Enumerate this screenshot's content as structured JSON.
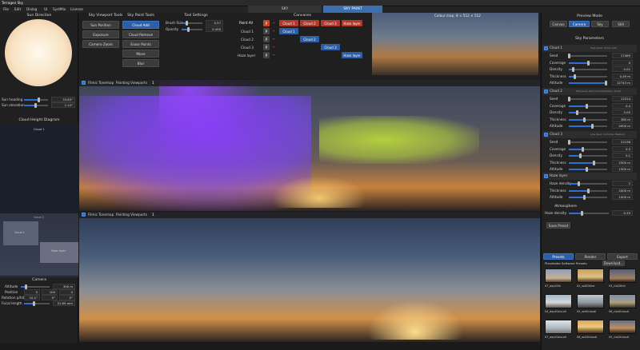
{
  "menu": {
    "title": "Terragen Sky",
    "items": [
      "File",
      "Edit",
      "Dialog",
      "UI",
      "SystMix",
      "License"
    ]
  },
  "top_tabs": [
    "SKY",
    "SKY PAINT"
  ],
  "sun": {
    "title": "Sun Direction",
    "heading_label": "Sun heading",
    "heading_value": "33.83°",
    "elevation_label": "Sun elevation",
    "elevation_value": "1.14°"
  },
  "cloud_diagram": {
    "title": "Cloud Height Diagram",
    "top_label": "Cloud 1",
    "mid_label": "Cloud 2",
    "box_a": "Cloud 1",
    "box_b": "Haze layer"
  },
  "camera": {
    "title": "Camera",
    "altitude_label": "Altitude",
    "altitude_value": "300 m",
    "position_label": "Position",
    "position_values": [
      "0",
      "100",
      "0"
    ],
    "rotation_label": "Rotation p/h/b",
    "rotation_values": [
      "10.1°",
      "0°",
      "0°"
    ],
    "focal_label": "Focal length",
    "focal_value": "31.69 mm"
  },
  "viewport_tools": {
    "title": "Sky Viewport Tools",
    "buttons": [
      "Sun Position",
      "Exposure",
      "Camera Zoom"
    ]
  },
  "paint_tools": {
    "title": "Sky Paint Tools",
    "buttons": [
      "Cloud Add",
      "Cloud Remove",
      "Erase Points",
      "Move",
      "Blur"
    ]
  },
  "tool_settings": {
    "title": "Tool Settings",
    "brush_label": "Brush Size",
    "brush_value": "0.57",
    "opacity_label": "Opacity",
    "opacity_value": "0.400"
  },
  "canvases": {
    "title": "Canvases",
    "rows": [
      "Paint All",
      "Cloud 1",
      "Cloud 2",
      "Cloud 3",
      "Haze layer"
    ],
    "p_label": "P",
    "chips": [
      "Cloud 1",
      "Cloud 2",
      "Cloud 3",
      "Haze layer"
    ]
  },
  "colour_map": {
    "label": "Colour map: 8 × 512 × 512"
  },
  "viewport1": {
    "toolbar_label": "Filmic Tonemap",
    "painting_label": "Painting Viewports",
    "page": "1"
  },
  "viewport2": {
    "toolbar_label": "Filmic Tonemap",
    "painting_label": "Painting Viewports",
    "page": "1"
  },
  "preview_mode": {
    "title": "Preview Mode",
    "buttons": [
      "Canvas",
      "Camera",
      "Sky",
      "Still"
    ]
  },
  "sky_parameters": {
    "title": "Sky Parameters",
    "cloud1": {
      "name": "Cloud 1",
      "hint": "High level: Cirrus (25)",
      "rows": [
        [
          "Seed",
          "27469"
        ],
        [
          "Coverage",
          "0"
        ],
        [
          "Density",
          "0.01"
        ],
        [
          "Thickness",
          "0.49 m"
        ],
        [
          "Altitude",
          "12743 m"
        ]
      ]
    },
    "cloud2": {
      "name": "Cloud 2",
      "hint": "Mid-level: Altocumulus/stratus, Small",
      "rows": [
        [
          "Seed",
          "12314"
        ],
        [
          "Coverage",
          "0.4"
        ],
        [
          "Density",
          "0.05"
        ],
        [
          "Thickness",
          "380 m"
        ],
        [
          "Altitude",
          "4000 m"
        ]
      ]
    },
    "cloud3": {
      "name": "Cloud 3",
      "hint": "Low level: Cumulus, Medium",
      "rows": [
        [
          "Seed",
          "22236"
        ],
        [
          "Coverage",
          "0.3"
        ],
        [
          "Density",
          "0.1"
        ],
        [
          "Thickness",
          "2500 m"
        ],
        [
          "Altitude",
          "1500 m"
        ]
      ]
    },
    "haze": {
      "name": "Haze layer",
      "rows": [
        [
          "Haze density",
          "2"
        ],
        [
          "Thickness",
          "2000 m"
        ],
        [
          "Altitude",
          "1000 m"
        ]
      ]
    },
    "atmosphere": {
      "title": "Atmosphere",
      "haze_label": "Haze density",
      "haze_value": "0.33"
    },
    "save_label": "Save Preset"
  },
  "presets": {
    "tabs": [
      "Presets",
      "Render",
      "Export"
    ],
    "source_label": "Planetside Software Presets",
    "download_label": "Download...",
    "items": [
      "07_day20th",
      "02_sat20thre",
      "03_clo20thh",
      "04_day40cloudl",
      "05_sehEcloudl",
      "06_clo40cloudl",
      "07_day20cloudl",
      "08_sel20cloudl",
      "09_clo20cloudl"
    ]
  }
}
